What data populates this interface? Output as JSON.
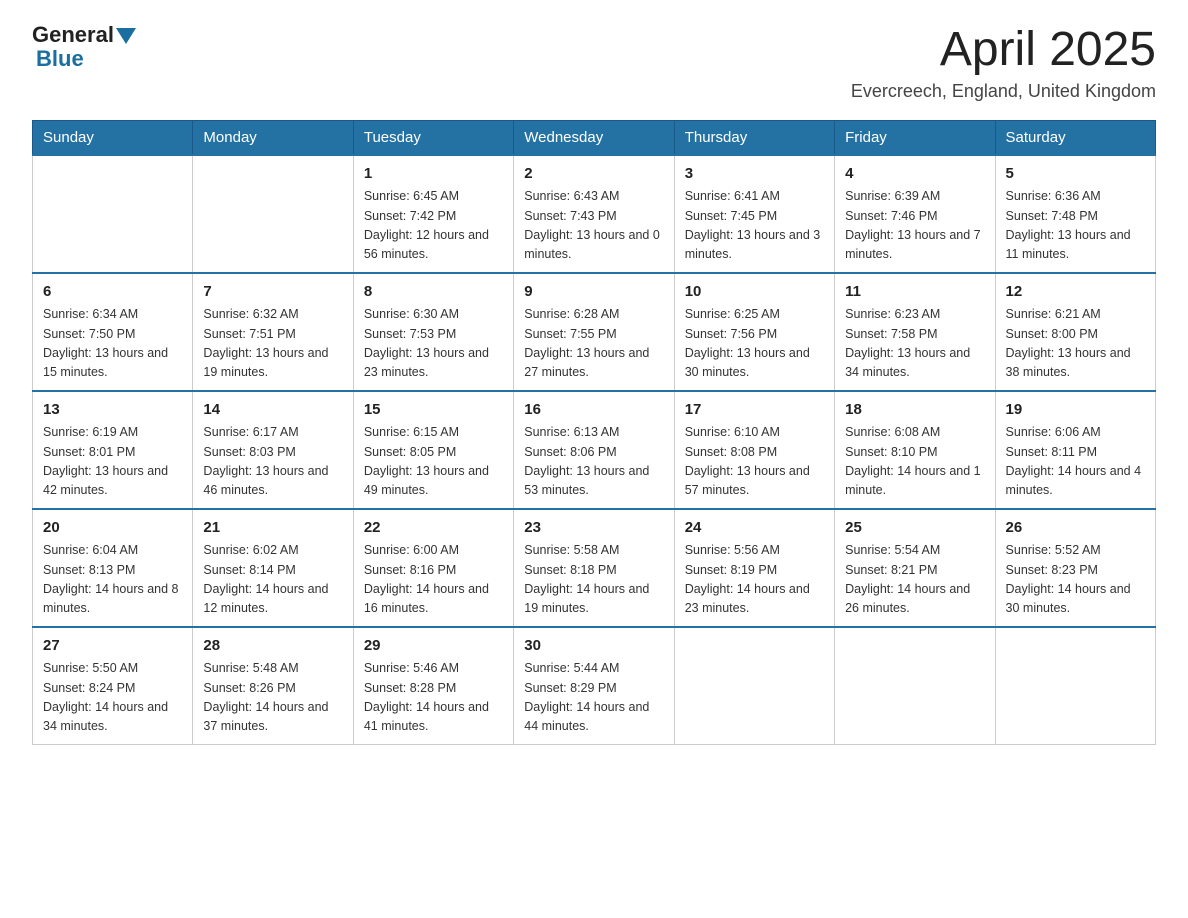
{
  "logo": {
    "general": "General",
    "blue": "Blue"
  },
  "title": "April 2025",
  "subtitle": "Evercreech, England, United Kingdom",
  "weekdays": [
    "Sunday",
    "Monday",
    "Tuesday",
    "Wednesday",
    "Thursday",
    "Friday",
    "Saturday"
  ],
  "weeks": [
    [
      {
        "day": "",
        "sunrise": "",
        "sunset": "",
        "daylight": ""
      },
      {
        "day": "",
        "sunrise": "",
        "sunset": "",
        "daylight": ""
      },
      {
        "day": "1",
        "sunrise": "Sunrise: 6:45 AM",
        "sunset": "Sunset: 7:42 PM",
        "daylight": "Daylight: 12 hours and 56 minutes."
      },
      {
        "day": "2",
        "sunrise": "Sunrise: 6:43 AM",
        "sunset": "Sunset: 7:43 PM",
        "daylight": "Daylight: 13 hours and 0 minutes."
      },
      {
        "day": "3",
        "sunrise": "Sunrise: 6:41 AM",
        "sunset": "Sunset: 7:45 PM",
        "daylight": "Daylight: 13 hours and 3 minutes."
      },
      {
        "day": "4",
        "sunrise": "Sunrise: 6:39 AM",
        "sunset": "Sunset: 7:46 PM",
        "daylight": "Daylight: 13 hours and 7 minutes."
      },
      {
        "day": "5",
        "sunrise": "Sunrise: 6:36 AM",
        "sunset": "Sunset: 7:48 PM",
        "daylight": "Daylight: 13 hours and 11 minutes."
      }
    ],
    [
      {
        "day": "6",
        "sunrise": "Sunrise: 6:34 AM",
        "sunset": "Sunset: 7:50 PM",
        "daylight": "Daylight: 13 hours and 15 minutes."
      },
      {
        "day": "7",
        "sunrise": "Sunrise: 6:32 AM",
        "sunset": "Sunset: 7:51 PM",
        "daylight": "Daylight: 13 hours and 19 minutes."
      },
      {
        "day": "8",
        "sunrise": "Sunrise: 6:30 AM",
        "sunset": "Sunset: 7:53 PM",
        "daylight": "Daylight: 13 hours and 23 minutes."
      },
      {
        "day": "9",
        "sunrise": "Sunrise: 6:28 AM",
        "sunset": "Sunset: 7:55 PM",
        "daylight": "Daylight: 13 hours and 27 minutes."
      },
      {
        "day": "10",
        "sunrise": "Sunrise: 6:25 AM",
        "sunset": "Sunset: 7:56 PM",
        "daylight": "Daylight: 13 hours and 30 minutes."
      },
      {
        "day": "11",
        "sunrise": "Sunrise: 6:23 AM",
        "sunset": "Sunset: 7:58 PM",
        "daylight": "Daylight: 13 hours and 34 minutes."
      },
      {
        "day": "12",
        "sunrise": "Sunrise: 6:21 AM",
        "sunset": "Sunset: 8:00 PM",
        "daylight": "Daylight: 13 hours and 38 minutes."
      }
    ],
    [
      {
        "day": "13",
        "sunrise": "Sunrise: 6:19 AM",
        "sunset": "Sunset: 8:01 PM",
        "daylight": "Daylight: 13 hours and 42 minutes."
      },
      {
        "day": "14",
        "sunrise": "Sunrise: 6:17 AM",
        "sunset": "Sunset: 8:03 PM",
        "daylight": "Daylight: 13 hours and 46 minutes."
      },
      {
        "day": "15",
        "sunrise": "Sunrise: 6:15 AM",
        "sunset": "Sunset: 8:05 PM",
        "daylight": "Daylight: 13 hours and 49 minutes."
      },
      {
        "day": "16",
        "sunrise": "Sunrise: 6:13 AM",
        "sunset": "Sunset: 8:06 PM",
        "daylight": "Daylight: 13 hours and 53 minutes."
      },
      {
        "day": "17",
        "sunrise": "Sunrise: 6:10 AM",
        "sunset": "Sunset: 8:08 PM",
        "daylight": "Daylight: 13 hours and 57 minutes."
      },
      {
        "day": "18",
        "sunrise": "Sunrise: 6:08 AM",
        "sunset": "Sunset: 8:10 PM",
        "daylight": "Daylight: 14 hours and 1 minute."
      },
      {
        "day": "19",
        "sunrise": "Sunrise: 6:06 AM",
        "sunset": "Sunset: 8:11 PM",
        "daylight": "Daylight: 14 hours and 4 minutes."
      }
    ],
    [
      {
        "day": "20",
        "sunrise": "Sunrise: 6:04 AM",
        "sunset": "Sunset: 8:13 PM",
        "daylight": "Daylight: 14 hours and 8 minutes."
      },
      {
        "day": "21",
        "sunrise": "Sunrise: 6:02 AM",
        "sunset": "Sunset: 8:14 PM",
        "daylight": "Daylight: 14 hours and 12 minutes."
      },
      {
        "day": "22",
        "sunrise": "Sunrise: 6:00 AM",
        "sunset": "Sunset: 8:16 PM",
        "daylight": "Daylight: 14 hours and 16 minutes."
      },
      {
        "day": "23",
        "sunrise": "Sunrise: 5:58 AM",
        "sunset": "Sunset: 8:18 PM",
        "daylight": "Daylight: 14 hours and 19 minutes."
      },
      {
        "day": "24",
        "sunrise": "Sunrise: 5:56 AM",
        "sunset": "Sunset: 8:19 PM",
        "daylight": "Daylight: 14 hours and 23 minutes."
      },
      {
        "day": "25",
        "sunrise": "Sunrise: 5:54 AM",
        "sunset": "Sunset: 8:21 PM",
        "daylight": "Daylight: 14 hours and 26 minutes."
      },
      {
        "day": "26",
        "sunrise": "Sunrise: 5:52 AM",
        "sunset": "Sunset: 8:23 PM",
        "daylight": "Daylight: 14 hours and 30 minutes."
      }
    ],
    [
      {
        "day": "27",
        "sunrise": "Sunrise: 5:50 AM",
        "sunset": "Sunset: 8:24 PM",
        "daylight": "Daylight: 14 hours and 34 minutes."
      },
      {
        "day": "28",
        "sunrise": "Sunrise: 5:48 AM",
        "sunset": "Sunset: 8:26 PM",
        "daylight": "Daylight: 14 hours and 37 minutes."
      },
      {
        "day": "29",
        "sunrise": "Sunrise: 5:46 AM",
        "sunset": "Sunset: 8:28 PM",
        "daylight": "Daylight: 14 hours and 41 minutes."
      },
      {
        "day": "30",
        "sunrise": "Sunrise: 5:44 AM",
        "sunset": "Sunset: 8:29 PM",
        "daylight": "Daylight: 14 hours and 44 minutes."
      },
      {
        "day": "",
        "sunrise": "",
        "sunset": "",
        "daylight": ""
      },
      {
        "day": "",
        "sunrise": "",
        "sunset": "",
        "daylight": ""
      },
      {
        "day": "",
        "sunrise": "",
        "sunset": "",
        "daylight": ""
      }
    ]
  ]
}
